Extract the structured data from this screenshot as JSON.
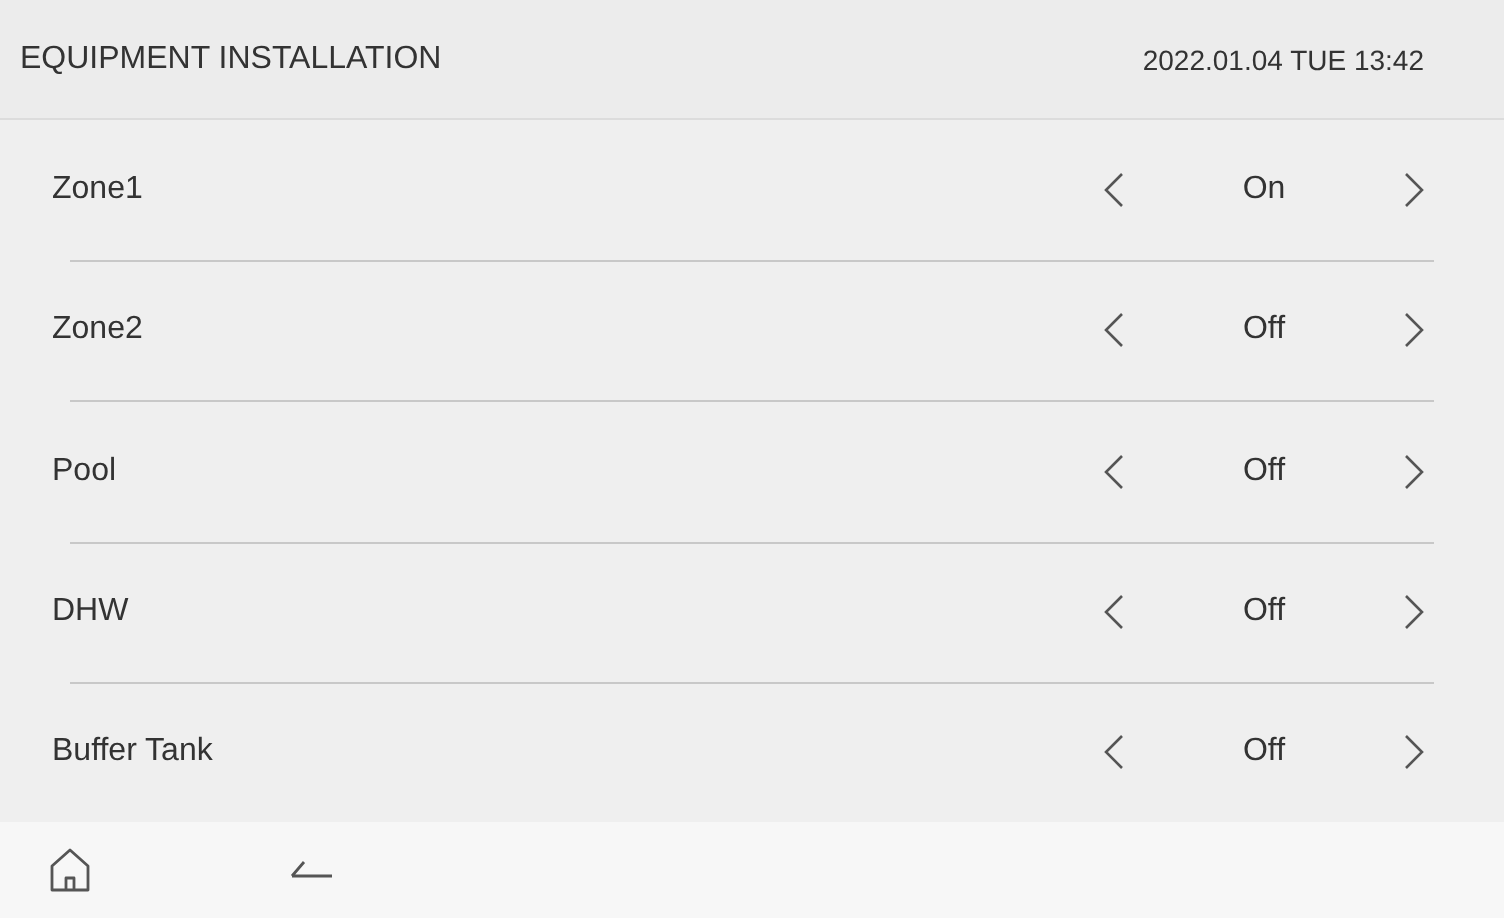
{
  "header": {
    "title": "EQUIPMENT INSTALLATION",
    "datetime": "2022.01.04 TUE 13:42"
  },
  "rows": [
    {
      "label": "Zone1",
      "value": "On"
    },
    {
      "label": "Zone2",
      "value": "Off"
    },
    {
      "label": "Pool",
      "value": "Off"
    },
    {
      "label": "DHW",
      "value": "Off"
    },
    {
      "label": "Buffer Tank",
      "value": "Off"
    }
  ]
}
